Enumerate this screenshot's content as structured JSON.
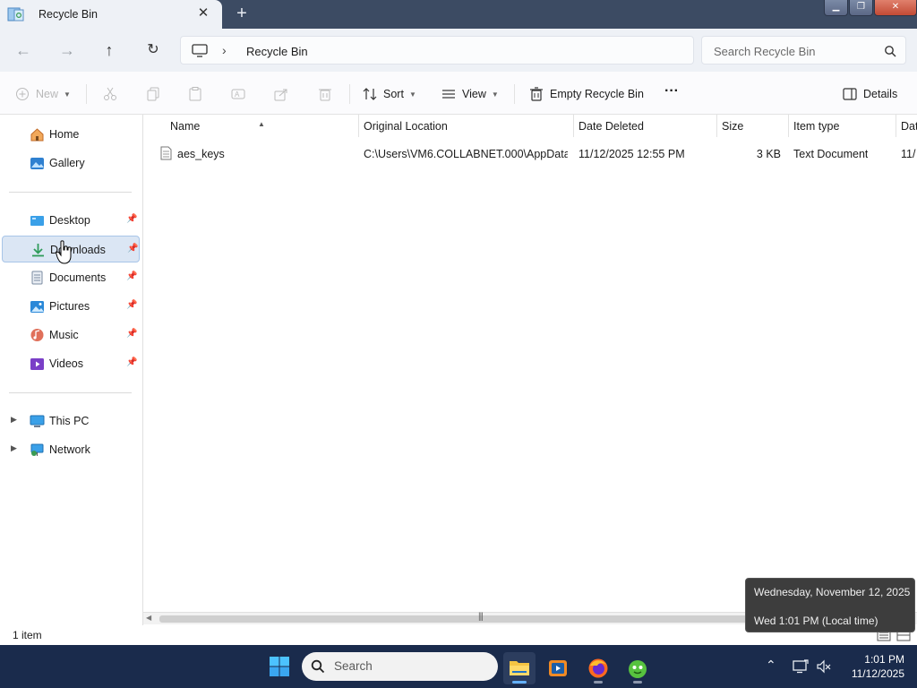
{
  "window": {
    "tab_title": "Recycle Bin",
    "tab_close": "✕",
    "new_tab": "+"
  },
  "nav": {
    "back": "←",
    "forward": "→",
    "up": "↑",
    "refresh": "↻",
    "breadcrumb_sep": "›",
    "breadcrumb": "Recycle Bin",
    "search_placeholder": "Search Recycle Bin"
  },
  "toolbar": {
    "new_label": "New",
    "sort_label": "Sort",
    "view_label": "View",
    "empty_label": "Empty Recycle Bin",
    "more_label": "···",
    "details_label": "Details"
  },
  "sidebar": {
    "top": [
      {
        "label": "Home",
        "icon": "home-icon"
      },
      {
        "label": "Gallery",
        "icon": "gallery-icon"
      }
    ],
    "quick": [
      {
        "label": "Desktop",
        "icon": "desktop-icon",
        "pinned": true
      },
      {
        "label": "Downloads",
        "icon": "downloads-icon",
        "pinned": true,
        "selected": true
      },
      {
        "label": "Documents",
        "icon": "documents-icon",
        "pinned": true
      },
      {
        "label": "Pictures",
        "icon": "pictures-icon",
        "pinned": true
      },
      {
        "label": "Music",
        "icon": "music-icon",
        "pinned": true
      },
      {
        "label": "Videos",
        "icon": "videos-icon",
        "pinned": true
      }
    ],
    "bottom": [
      {
        "label": "This PC",
        "icon": "this-pc-icon"
      },
      {
        "label": "Network",
        "icon": "network-icon"
      }
    ]
  },
  "table": {
    "columns": [
      "Name",
      "Original Location",
      "Date Deleted",
      "Size",
      "Item type",
      "Dat"
    ],
    "rows": [
      {
        "name": "aes_keys",
        "location": "C:\\Users\\VM6.COLLABNET.000\\AppData...",
        "date_deleted": "11/12/2025 12:55 PM",
        "size": "3 KB",
        "type": "Text Document",
        "date_trunc": "11/"
      }
    ]
  },
  "status": {
    "item_count": "1 item"
  },
  "tooltip": {
    "line1": "Wednesday, November 12, 2025",
    "line2": "Wed 1:01 PM (Local time)"
  },
  "taskbar": {
    "search_label": "Search",
    "time": "1:01 PM",
    "date": "11/12/2025"
  },
  "colors": {
    "title_bar": "#3c4b63",
    "chrome": "#eef1f6",
    "selection": "#dbe6f4",
    "taskbar": "#1a2b4c",
    "accent": "#64b1ff"
  }
}
